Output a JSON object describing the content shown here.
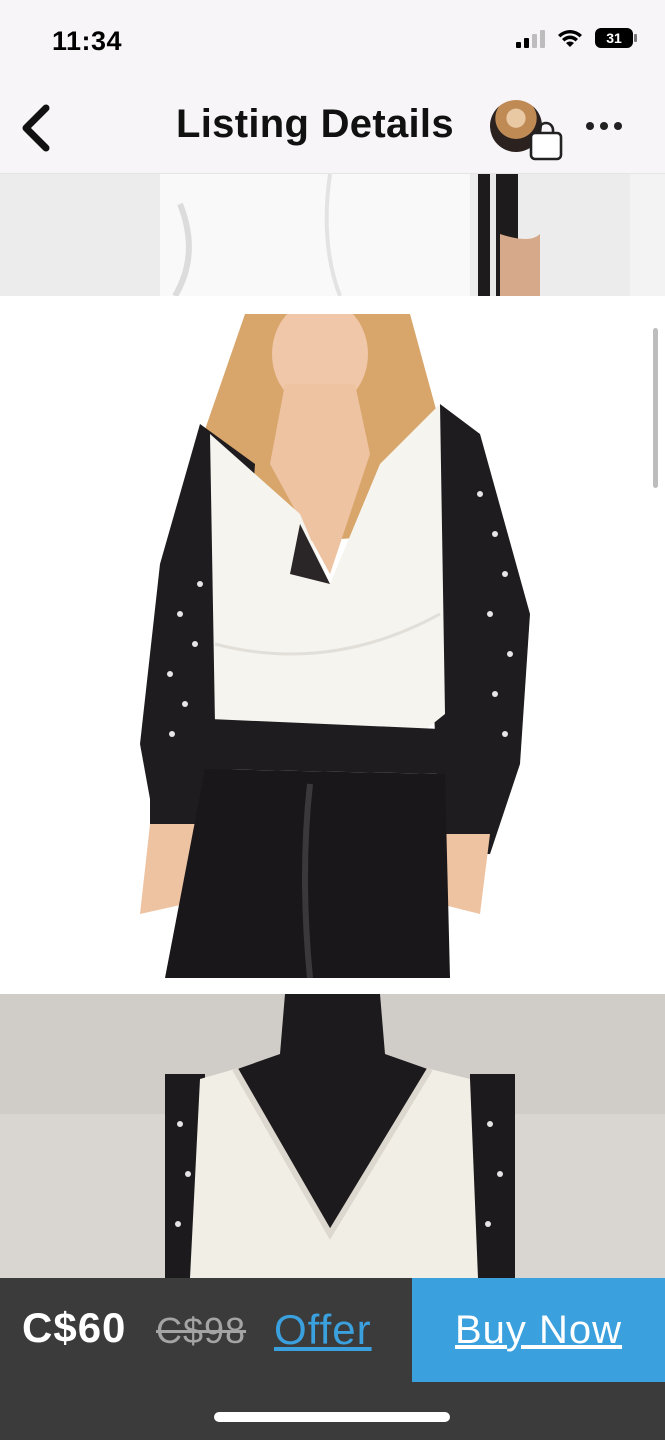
{
  "status": {
    "time": "11:34",
    "battery": "31"
  },
  "nav": {
    "title": "Listing Details",
    "back_icon": "chevron-left-icon",
    "bag_icon": "shopping-bag-icon",
    "more_icon": "more-horizontal-icon"
  },
  "listing": {
    "price": "C$60",
    "original_price": "C$98",
    "offer_label": "Offer",
    "buy_label": "Buy Now"
  },
  "colors": {
    "accent": "#3aa0de",
    "bottom_bar": "#3b3b3b",
    "header_bg": "#f7f5f7"
  }
}
